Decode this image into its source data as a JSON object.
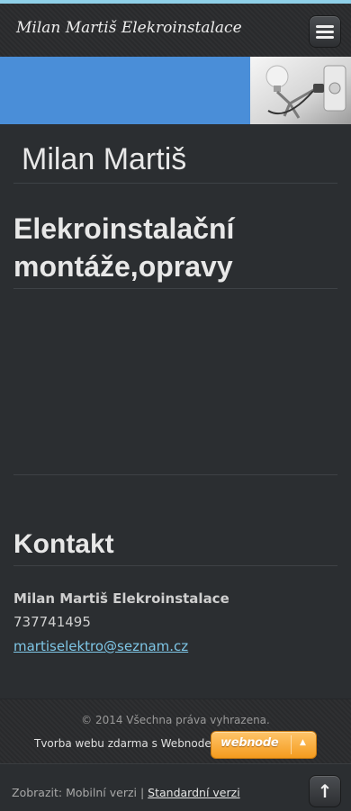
{
  "header": {
    "site_title": "Milan Martiš Elekroinstalace",
    "menu_icon": "hamburger-menu-icon"
  },
  "colors": {
    "banner": "#4a8ed8",
    "background": "#2b2e31",
    "link": "#7ec6e6",
    "webnode_orange": "#f49b1e"
  },
  "main": {
    "heading": "Milan Martiš",
    "subheading": "Elekroinstalační montáže,opravy",
    "contact": {
      "title": "Kontakt",
      "name": "Milan Martiš Elekroinstalace",
      "phone": "737741495",
      "email": "martiselektro@seznam.cz"
    }
  },
  "footer": {
    "copyright": "© 2014 Všechna práva vyhrazena.",
    "webnode_text": "Tvorba webu zdarma s Webnode",
    "webnode_badge": "webnode"
  },
  "bottombar": {
    "view_label": "Zobrazit: Mobilní verzi | ",
    "standard_link": "Standardní verzi",
    "top_icon": "arrow-up-icon"
  }
}
